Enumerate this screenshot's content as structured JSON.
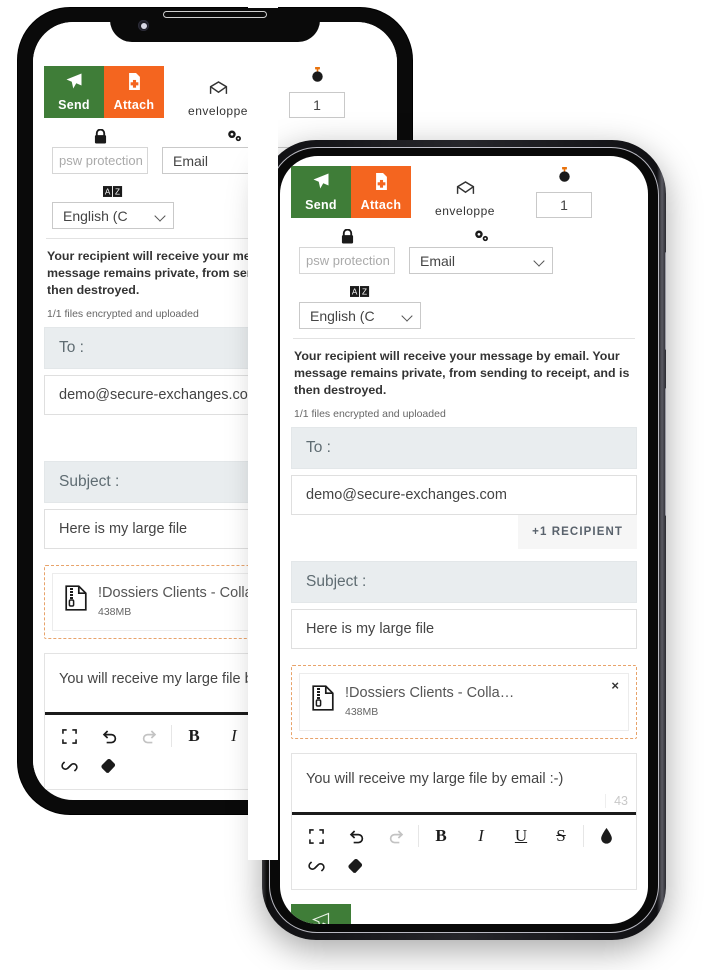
{
  "app": {
    "toolbar": {
      "send_label": "Send",
      "send_icon": "paper-plane-icon",
      "attach_label": "Attach",
      "attach_icon": "file-add-icon",
      "envelope_label": "enveloppe",
      "envelope_icon": "open-envelope-icon",
      "timer_icon": "stopwatch-icon",
      "timer_value": "1"
    },
    "options": {
      "password_icon": "lock-icon",
      "password_placeholder": "psw protection",
      "transfer_icon": "gears-icon",
      "transfer_type": "Email",
      "language_icon": "translate-icon",
      "language": "English (C"
    },
    "notice": "Your recipient will receive your message by email. Your message remains private, from sending to receipt, and is then destroyed.",
    "upload_status": "1/1 files encrypted and uploaded",
    "form": {
      "to_label": "To :",
      "to_value": "demo@secure-exchanges.com",
      "recipient_button": "+1 RECIPIENT",
      "subject_label": "Subject :",
      "subject_value": "Here is my large file"
    },
    "attachment": {
      "icon": "zip-file-icon",
      "name": "!Dossiers Clients - Colla…",
      "size": "438MB",
      "remove_icon": "close-icon"
    },
    "editor": {
      "body_text": "You will receive my large file by email :-)",
      "char_count": "43",
      "tools": [
        {
          "name": "fullscreen-icon",
          "glyph": "",
          "disabled": false
        },
        {
          "name": "undo-icon",
          "glyph": "↺",
          "disabled": false
        },
        {
          "name": "redo-icon",
          "glyph": "↻",
          "disabled": true
        },
        {
          "name": "bold-icon",
          "glyph": "B",
          "disabled": false
        },
        {
          "name": "italic-icon",
          "glyph": "I",
          "disabled": false
        },
        {
          "name": "underline-icon",
          "glyph": "U",
          "disabled": false
        },
        {
          "name": "strikethrough-icon",
          "glyph": "S",
          "disabled": false
        },
        {
          "name": "text-color-icon",
          "glyph": "",
          "disabled": false
        },
        {
          "name": "link-icon",
          "glyph": "",
          "disabled": false
        },
        {
          "name": "eraser-icon",
          "glyph": "",
          "disabled": false
        }
      ]
    }
  },
  "colors": {
    "send_green": "#3f7d38",
    "attach_orange": "#f4651f",
    "label_bar": "#e9edef",
    "dashed_border": "#e8a36a",
    "phone_body": "#0a0a0a"
  }
}
